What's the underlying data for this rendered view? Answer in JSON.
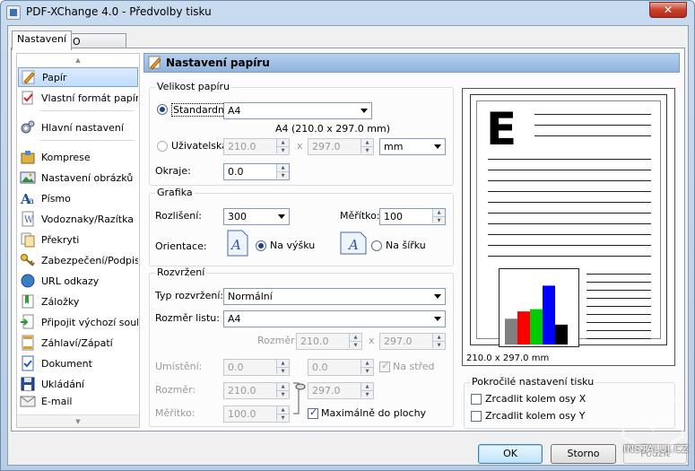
{
  "window": {
    "title": "PDF-XChange 4.0 - Předvolby tisku",
    "close": "✕"
  },
  "tabs": [
    {
      "label": "Nastavení"
    },
    {
      "label": "O programu"
    }
  ],
  "nav": {
    "items": [
      {
        "label": "Papír"
      },
      {
        "label": "Vlastní formát papíru"
      },
      {
        "label": "Hlavní nastavení"
      },
      {
        "label": "Komprese"
      },
      {
        "label": "Nastavení obrázků"
      },
      {
        "label": "Písmo"
      },
      {
        "label": "Vodoznaky/Razítka"
      },
      {
        "label": "Překryti"
      },
      {
        "label": "Zabezpečení/Podpisy"
      },
      {
        "label": "URL odkazy"
      },
      {
        "label": "Záložky"
      },
      {
        "label": "Připojit výchozí soubor"
      },
      {
        "label": "Záhlaví/Zápatí"
      },
      {
        "label": "Dokument"
      },
      {
        "label": "Ukládání"
      },
      {
        "label": "E-mail"
      }
    ]
  },
  "header": {
    "title": "Nastavení papíru"
  },
  "paper_size": {
    "group_title": "Velikost papíru",
    "standard_label": "Standardní",
    "standard_value": "A4",
    "standard_dims": "A4 (210.0 x 297.0 mm)",
    "custom_label": "Uživatelská",
    "width": "210.0",
    "x": "x",
    "height": "297.0",
    "unit": "mm",
    "margins_label": "Okraje:",
    "margins_value": "0.0"
  },
  "graphics": {
    "group_title": "Grafika",
    "resolution_label": "Rozlišení:",
    "resolution_value": "300",
    "scale_label": "Měřítko:",
    "scale_value": "100",
    "orientation_label": "Orientace:",
    "portrait_label": "Na výšku",
    "landscape_label": "Na šířku"
  },
  "layout": {
    "group_title": "Rozvržení",
    "type_label": "Typ rozvržení:",
    "type_value": "Normální",
    "sheet_label": "Rozměr listu:",
    "sheet_value": "A4",
    "size_label": "Rozměr:",
    "size_w": "210.0",
    "x": "x",
    "size_h": "297.0",
    "placement_label": "Umístění:",
    "placement_x": "0.0",
    "placement_y": "0.0",
    "center_label": "Na střed",
    "dim_label": "Rozměr:",
    "dim_w": "210.0",
    "dim_h": "297.0",
    "scale_label": "Měřítko:",
    "scale_value": "100.0",
    "maximize_label": "Maximálně do plochy"
  },
  "preview": {
    "big_letter": "E",
    "size_text": "210.0 x 297.0 mm",
    "chart_data": {
      "type": "bar",
      "values": [
        35,
        45,
        48,
        80,
        27
      ],
      "colors": [
        "#808080",
        "#ff0000",
        "#00cc00",
        "#0000ff",
        "#000000"
      ],
      "ylim": [
        0,
        100
      ]
    }
  },
  "advanced": {
    "group_title": "Pokročilé nastavení tisku",
    "mirror_x": "Zrcadlit kolem osy X",
    "mirror_y": "Zrcadlit kolem osy Y"
  },
  "buttons": {
    "ok": "OK",
    "cancel": "Storno",
    "apply": "Použít"
  },
  "watermark": {
    "text": "INSTALUJ.CZ"
  }
}
